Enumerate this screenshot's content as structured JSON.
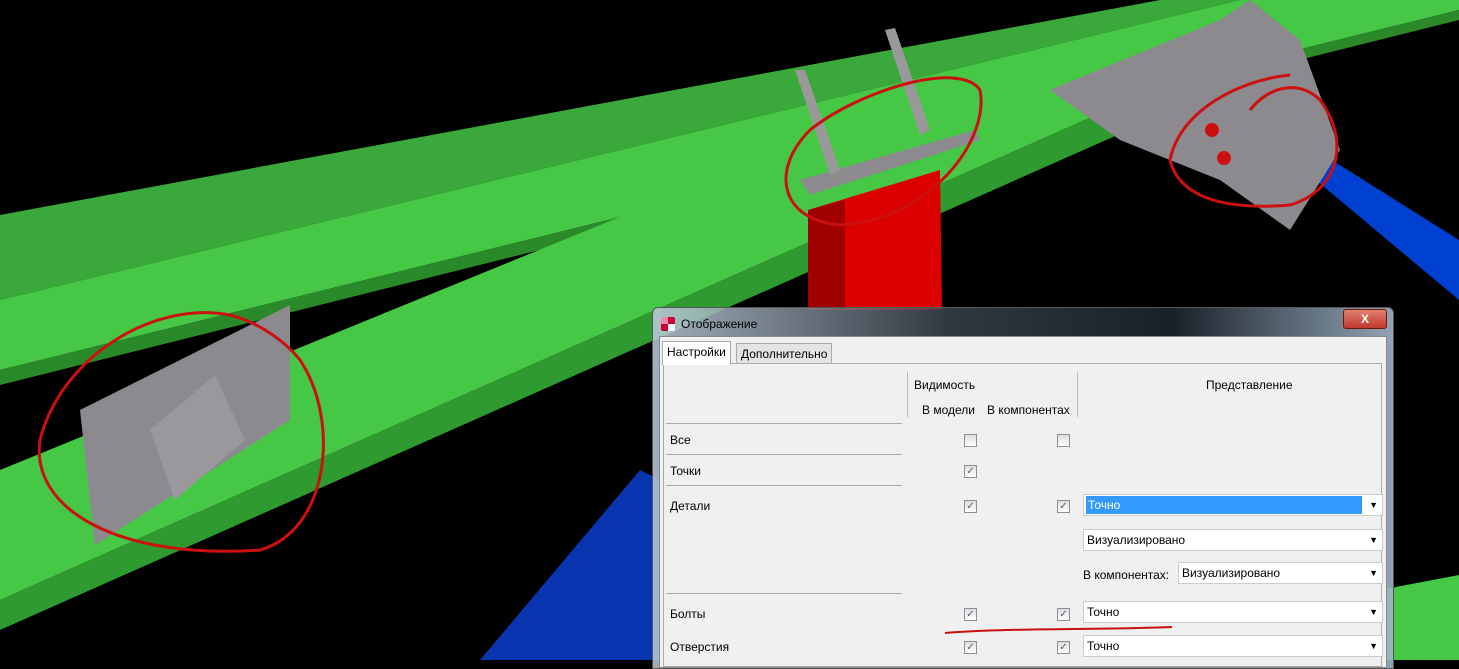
{
  "dialog": {
    "title": "Отображение",
    "close_label": "X",
    "tabs": [
      {
        "label": "Настройки",
        "active": true
      },
      {
        "label": "Дополнительно",
        "active": false
      }
    ],
    "headers": {
      "visibility": "Видимость",
      "in_model": "В модели",
      "in_components": "В компонентах",
      "representation": "Представление"
    },
    "rows": {
      "all": {
        "label": "Все",
        "in_model": false,
        "in_components": false
      },
      "points": {
        "label": "Точки",
        "in_model": true
      },
      "parts": {
        "label": "Детали",
        "in_model": true,
        "in_components": true,
        "representation": "Точно",
        "representation2": "Визуализировано",
        "components_label": "В компонентах:",
        "components_value": "Визуализировано"
      },
      "bolts": {
        "label": "Болты",
        "in_model": true,
        "in_components": true,
        "representation": "Точно"
      },
      "holes": {
        "label": "Отверстия",
        "in_model": true,
        "in_components": true,
        "representation": "Точно"
      }
    },
    "check_glyph": "✓",
    "arrow_glyph": "▼"
  },
  "colors": {
    "beam": "#46c846",
    "column": "#dd0000",
    "brace": "#0040d0",
    "plate": "#8c8a8e",
    "markup": "#cc1010"
  }
}
